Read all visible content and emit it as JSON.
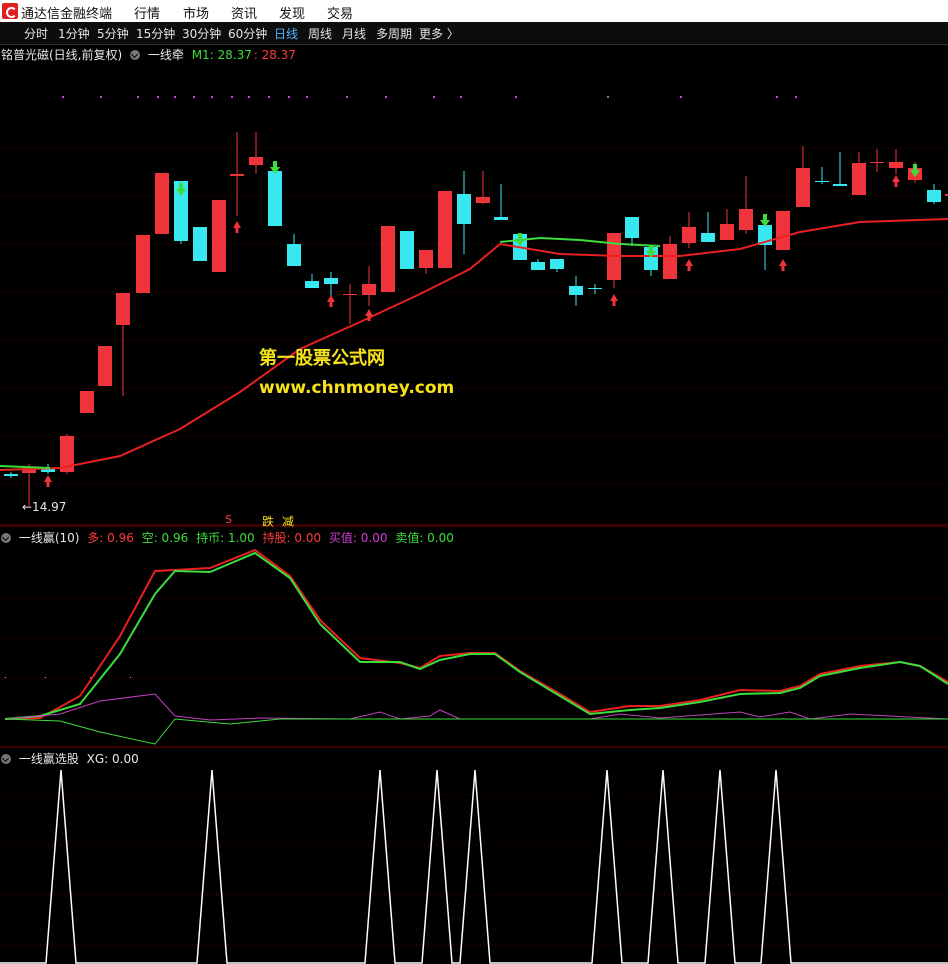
{
  "titlebar": {
    "app_name": "通达信金融终端",
    "menus": [
      "行情",
      "市场",
      "资讯",
      "发现",
      "交易"
    ]
  },
  "periods": {
    "items": [
      "分时",
      "1分钟",
      "5分钟",
      "15分钟",
      "30分钟",
      "60分钟",
      "日线",
      "周线",
      "月线",
      "多周期",
      "更多 〉"
    ],
    "active": "日线"
  },
  "main_panel": {
    "title": "铭普光磁(日线,前复权)",
    "indicator": "一线牵",
    "m1_label": "M1: 28.37",
    "m1_value2": ": 28.37",
    "low_marker": "←14.97",
    "signals": [
      "S",
      "跌",
      "减"
    ]
  },
  "watermark": {
    "line1": "第一股票公式网",
    "line2": "www.chnmoney.com"
  },
  "panel2": {
    "title": "一线赢(10)",
    "fields": [
      {
        "label": "多: 0.96",
        "color": "#ff3b3b"
      },
      {
        "label": "空: 0.96",
        "color": "#3ddc3d"
      },
      {
        "label": "持币: 1.00",
        "color": "#3ddc3d"
      },
      {
        "label": "持股: 0.00",
        "color": "#ff3b3b"
      },
      {
        "label": "买值: 0.00",
        "color": "#d040d0"
      },
      {
        "label": "卖值: 0.00",
        "color": "#3ddc3d"
      }
    ]
  },
  "panel3": {
    "title": "一线赢选股",
    "xg_label": "XG: 0.00"
  },
  "colors": {
    "up": "#f0343c",
    "down": "#38e8f0",
    "ma_red": "#e82020",
    "ma_green": "#3ddc3d",
    "magenta": "#c040c0",
    "grid": "#5a0000"
  }
}
